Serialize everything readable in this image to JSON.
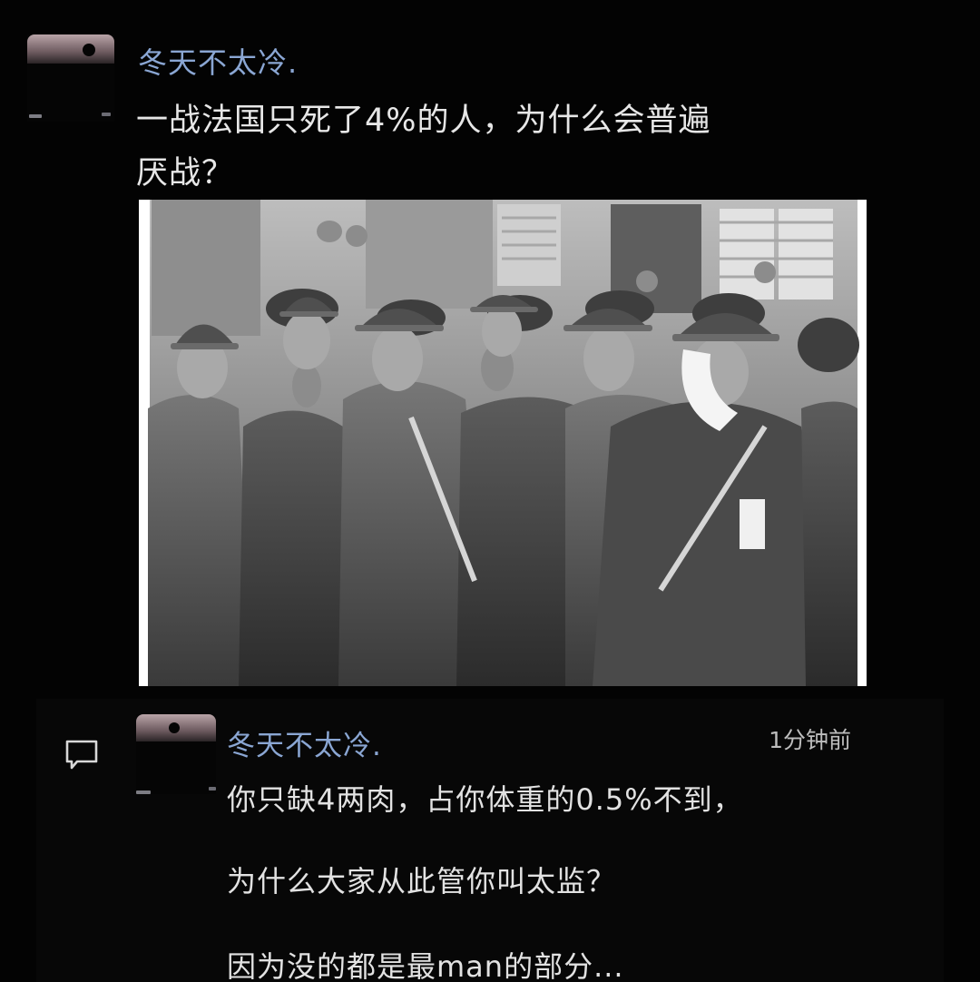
{
  "post": {
    "username": "冬天不太冷.",
    "text_line1": "一战法国只死了4%的人，为什么会普遍",
    "text_line2": "厌战？"
  },
  "reply": {
    "username": "冬天不太冷.",
    "time": "1分钟前",
    "lines": [
      "你只缺4两肉，占你体重的0.5%不到，",
      "为什么大家从此管你叫太监？",
      "因为没的都是最man的部分..."
    ]
  },
  "icons": {
    "comment": "comment-icon"
  },
  "colors": {
    "background": "#030303",
    "username": "#8aa6d3",
    "text": "#e7e7e7",
    "time": "#bdbdbd"
  }
}
